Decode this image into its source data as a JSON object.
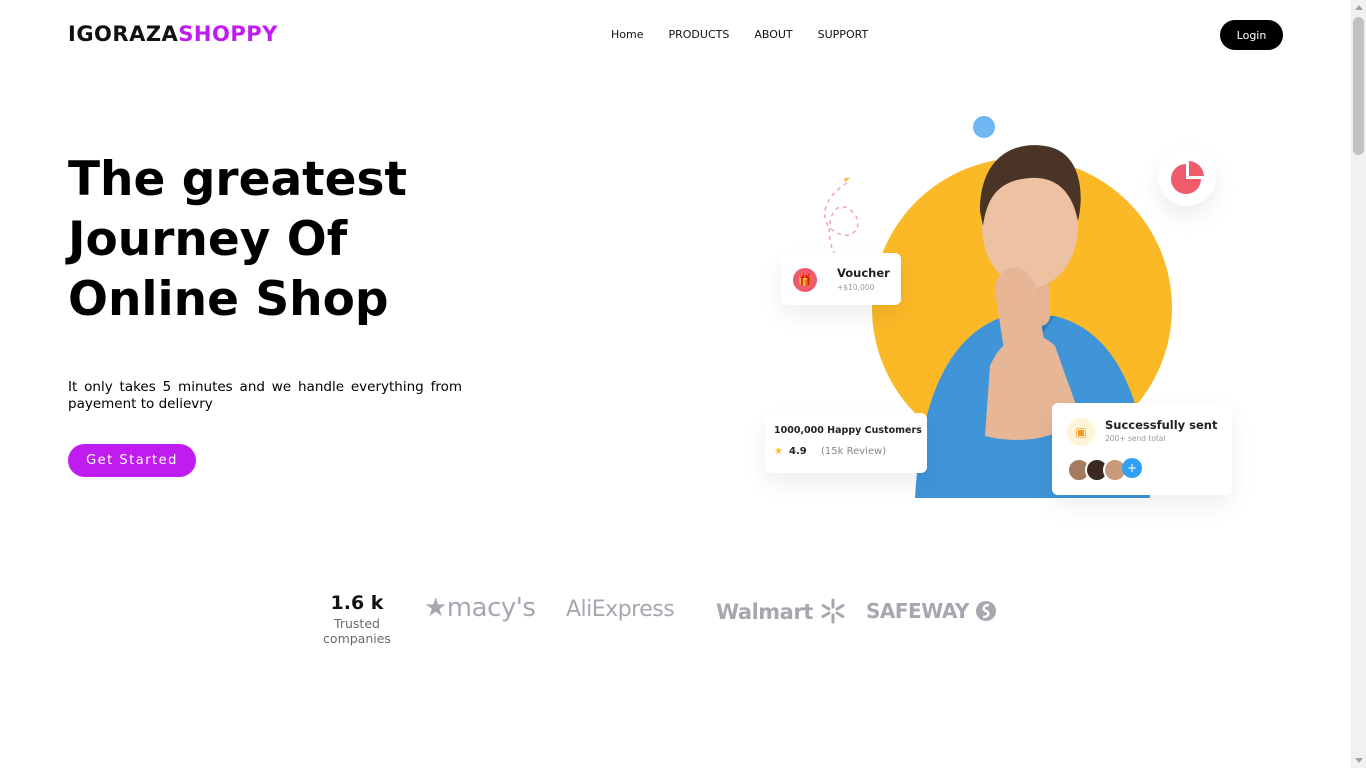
{
  "header": {
    "logo_part1": "IGORAZA",
    "logo_part2": "SHOPPY",
    "nav": [
      {
        "label": "Home"
      },
      {
        "label": "PRODUCTS"
      },
      {
        "label": "ABOUT"
      },
      {
        "label": "SUPPORT"
      }
    ],
    "login_label": "Login"
  },
  "hero": {
    "title_line1": "The greatest",
    "title_line2": "Journey Of",
    "title_line3": "Online Shop",
    "subtitle": "It only takes 5 minutes and we handle everything from payement to delievry",
    "cta_label": "Get Started"
  },
  "illustration": {
    "voucher_title": "Voucher",
    "voucher_amount": "+$10,000",
    "customers_text": "1000,000 Happy Customers",
    "rating": "4.9",
    "reviews": "(15k Review)",
    "sent_title": "Successfully sent",
    "sent_sub": "200+ send total",
    "accent_yellow": "#fbb827",
    "accent_red": "#ef5b6b"
  },
  "trusted": {
    "count": "1.6 k",
    "label_line1": "Trusted",
    "label_line2": "companies",
    "brands": [
      "★macy's",
      "AliExpress",
      "Walmart",
      "SAFEWAY"
    ]
  },
  "theme": {
    "brand_purple": "#c01cf0",
    "dark": "#000000"
  }
}
